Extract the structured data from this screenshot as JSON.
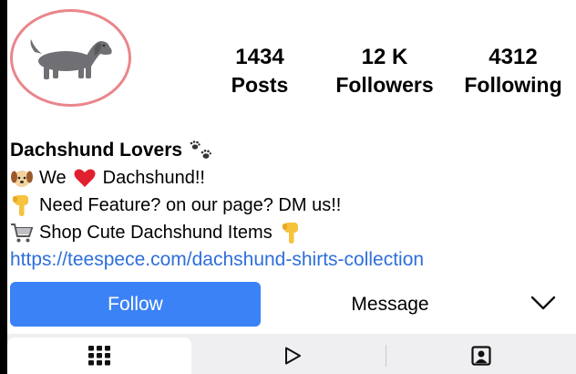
{
  "profile": {
    "stats": [
      {
        "value": "1434",
        "label": "Posts"
      },
      {
        "value": "12 K",
        "label": "Followers"
      },
      {
        "value": "4312",
        "label": "Following"
      }
    ],
    "name": "Dachshund Lovers",
    "bio_lines": [
      {
        "icon": "puppy-face-icon",
        "pre": "We",
        "heart_icon": "red-heart-icon",
        "post": "Dachshund!!"
      },
      {
        "icon": "pointing-down-icon",
        "text": "Need Feature? on our page? DM us!!"
      },
      {
        "icon": "shopping-cart-icon",
        "text": "Shop Cute Dachshund Items",
        "after_icon": "pointing-down-icon"
      }
    ],
    "link": "https://teespece.com/dachshund-shirts-collection"
  },
  "actions": {
    "follow_label": "Follow",
    "message_label": "Message"
  },
  "tabs": [
    "grid-icon",
    "reels-play-icon",
    "tagged-person-icon"
  ],
  "colors": {
    "follow_button": "#3b82f6",
    "link": "#2e6fd9",
    "avatar_ring": "#e9868b",
    "tabbar_bg": "#efeff1"
  }
}
